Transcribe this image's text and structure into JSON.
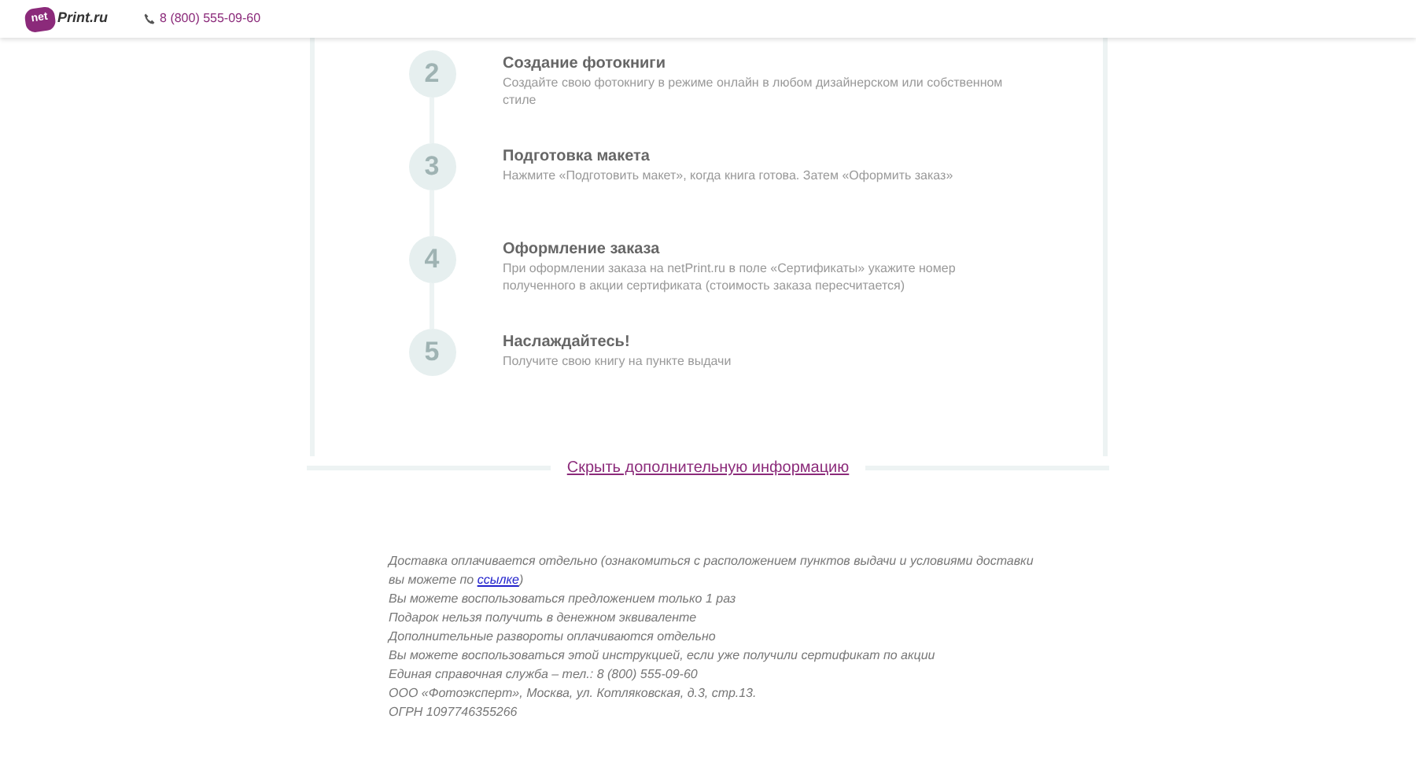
{
  "header": {
    "logo_badge": "net",
    "logo_text": "Print.ru",
    "phone": "8 (800) 555-09-60"
  },
  "steps": [
    {
      "number": "2",
      "title": "Создание фотокниги",
      "text": "Создайте свою фотокнигу в режиме онлайн в любом дизайнерском или собственном стиле"
    },
    {
      "number": "3",
      "title": "Подготовка макета",
      "text": "Нажмите «Подготовить макет», когда книга готова. Затем «Оформить заказ»"
    },
    {
      "number": "4",
      "title": "Оформление заказа",
      "text": "При оформлении заказа на netPrint.ru в поле «Сертификаты» укажите номер полученного в акции сертификата (стоимость заказа пересчитается)"
    },
    {
      "number": "5",
      "title": "Наслаждайтесь!",
      "text": "Получите свою книгу на пункте выдачи"
    }
  ],
  "hide_link": "Скрыть дополнительную информацию",
  "notes": [
    {
      "text": "Доставка оплачивается отдельно (ознакомиться с расположением пунктов выдачи и условиями доставки вы можете по",
      "link": "ссылке",
      "after": ")"
    },
    {
      "text": "Вы можете воспользоваться предложением только 1 раз"
    },
    {
      "text": "Подарок нельзя получить в денежном эквиваленте"
    },
    {
      "text": "Дополнительные развороты оплачиваются отдельно"
    },
    {
      "text": "Вы можете воспользоваться этой инструкцией, если уже получили сертификат по акции"
    },
    {
      "text": "Единая справочная служба – тел.: 8 (800) 555-09-60"
    },
    {
      "text": "ООО «Фотоэксперт», Москва, ул. Котляковская, д.3, стр.13."
    },
    {
      "text": "ОГРН 1097746355266"
    }
  ]
}
